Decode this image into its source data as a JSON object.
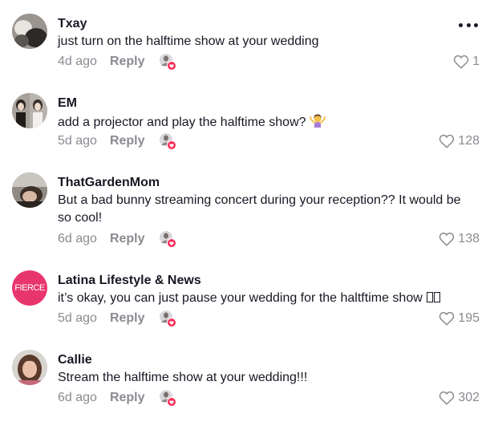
{
  "comments": [
    {
      "username": "Txay",
      "text": "just turn on the halftime show at your wedding",
      "time": "4d ago",
      "reply_label": "Reply",
      "likes": "1"
    },
    {
      "username": "EM",
      "text": "add a projector and play the halftime show?",
      "time": "5d ago",
      "reply_label": "Reply",
      "likes": "128"
    },
    {
      "username": "ThatGardenMom",
      "text": "But a bad bunny streaming concert during your reception?? It would be so cool!",
      "time": "6d ago",
      "reply_label": "Reply",
      "likes": "138"
    },
    {
      "username": "Latina Lifestyle & News",
      "avatar_text": "FIERCE",
      "text": "it’s okay, you can just pause your wedding for the haltftime show",
      "time": "5d ago",
      "reply_label": "Reply",
      "likes": "195"
    },
    {
      "username": "Callie",
      "text": "Stream the halftime show at your wedding!!!",
      "time": "6d ago",
      "reply_label": "Reply",
      "likes": "302"
    }
  ],
  "icons": {
    "more": "more-options-icon",
    "like": "heart-icon",
    "creator_liked": "creator-liked-avatar-icon",
    "emoji": "shrug-person-emoji-icon"
  },
  "colors": {
    "secondary_text": "#8a8b91",
    "fierce_brand": "#e8356d",
    "creator_like_badge": "#fe2c55"
  }
}
